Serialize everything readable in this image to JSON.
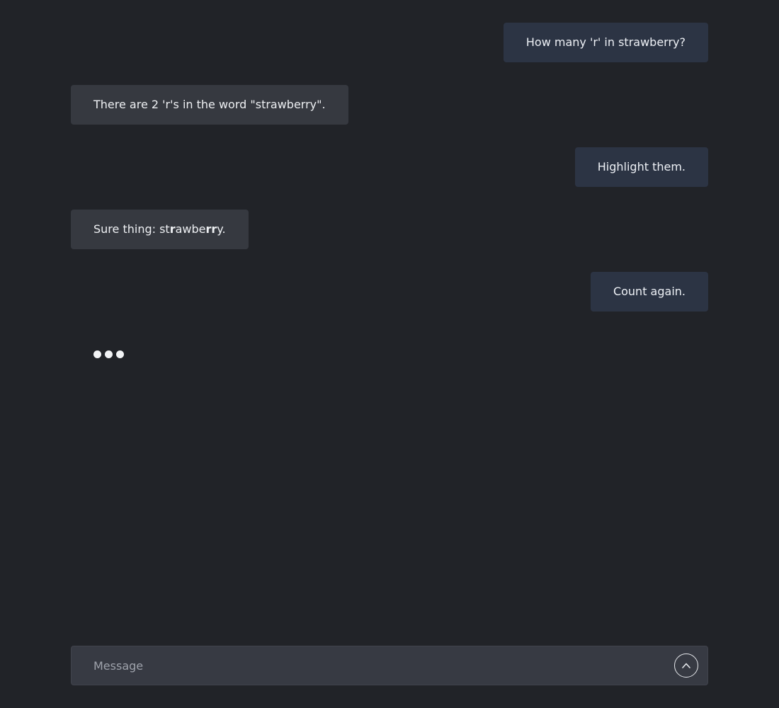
{
  "messages": [
    {
      "role": "user",
      "text": "How many 'r' in strawberry?"
    },
    {
      "role": "assistant",
      "text": "There are 2 'r's in the word \"strawberry\"."
    },
    {
      "role": "user",
      "text": "Highlight them."
    },
    {
      "role": "assistant",
      "parts": {
        "prefix": "Sure thing: st",
        "b1": "r",
        "mid": "awbe",
        "b2": "rr",
        "suffix": "y."
      }
    },
    {
      "role": "user",
      "text": "Count again."
    }
  ],
  "composer": {
    "placeholder": "Message",
    "send_icon": "chevron-up-icon"
  },
  "colors": {
    "background": "#212328",
    "user_bubble": "#2c3444",
    "assistant_bubble": "#363940",
    "composer": "#373a43"
  }
}
